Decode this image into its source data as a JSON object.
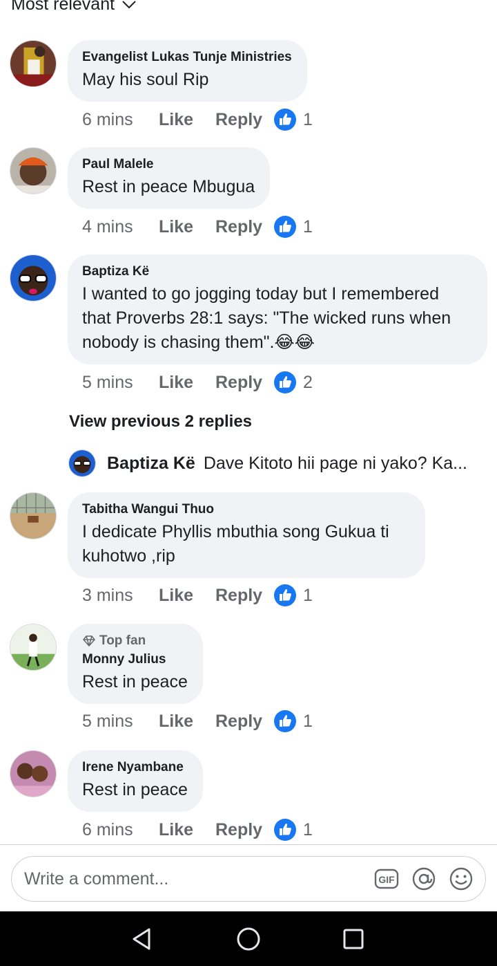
{
  "sort": {
    "label": "Most relevant",
    "icon": "chevron-down-icon"
  },
  "actions_labels": {
    "like": "Like",
    "reply": "Reply"
  },
  "comments": [
    {
      "author": "Evangelist  Lukas Tunje Ministries",
      "text": "May his soul Rip",
      "time": "6 mins",
      "reactions": "1"
    },
    {
      "author": "Paul Malele",
      "text": "Rest in peace Mbugua",
      "time": "4 mins",
      "reactions": "1"
    },
    {
      "author": "Baptiza Kë",
      "text_lines": [
        "I wanted to go jogging today but I remembered",
        "that Proverbs 28:1 says: \"The wicked runs when",
        "nobody is chasing them\"."
      ],
      "emoji": "😂😂",
      "time": "5 mins",
      "reactions": "2"
    },
    {
      "author": "Tabitha Wangui Thuo",
      "text_lines": [
        "I dedicate Phyllis mbuthia song Gukua ti",
        "kuhotwo ,rip"
      ],
      "time": "3 mins",
      "reactions": "1"
    },
    {
      "badge": "Top fan",
      "author": "Monny Julius",
      "text": "Rest in peace",
      "time": "5 mins",
      "reactions": "1"
    },
    {
      "author": "Irene Nyambane",
      "text": "Rest in peace",
      "time": "6 mins",
      "reactions": "1"
    }
  ],
  "replies": {
    "view_previous": "View previous 2 replies",
    "preview": {
      "author": "Baptiza Kë",
      "text": "Dave Kitoto hii page ni yako? Ka..."
    }
  },
  "composer": {
    "placeholder": "Write a comment...",
    "icons": [
      "gif-icon",
      "mention-icon",
      "emoji-icon"
    ]
  },
  "colors": {
    "like_blue": "#1877f2",
    "bubble": "#f0f2f5",
    "secondary_text": "#65676b"
  }
}
